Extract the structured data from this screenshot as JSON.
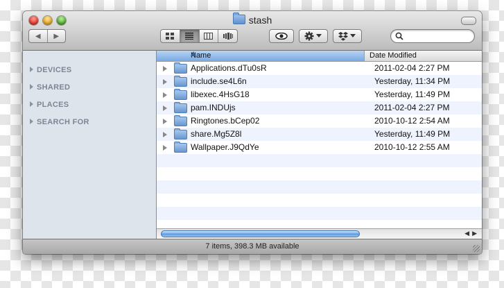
{
  "window": {
    "title": "stash"
  },
  "toolbar": {
    "back_glyph": "◀",
    "forward_glyph": "▶",
    "view_modes": [
      "icon-view",
      "list-view",
      "column-view",
      "coverflow-view"
    ],
    "active_view": "list-view",
    "search": {
      "value": "",
      "placeholder": ""
    }
  },
  "sidebar": {
    "sections": [
      {
        "label": "DEVICES"
      },
      {
        "label": "SHARED"
      },
      {
        "label": "PLACES"
      },
      {
        "label": "SEARCH FOR"
      }
    ]
  },
  "list": {
    "columns": [
      {
        "label": "Name",
        "sorted": true
      },
      {
        "label": "Date Modified"
      }
    ],
    "rows": [
      {
        "name": "Applications.dTu0sR",
        "date": "2011-02-04 2:27 PM"
      },
      {
        "name": "include.se4L6n",
        "date": "Yesterday, 11:34 PM"
      },
      {
        "name": "libexec.4HsG18",
        "date": "Yesterday, 11:49 PM"
      },
      {
        "name": "pam.INDUjs",
        "date": "2011-02-04 2:27 PM"
      },
      {
        "name": "Ringtones.bCep02",
        "date": "2010-10-12 2:54 AM"
      },
      {
        "name": "share.Mg5Z8l",
        "date": "Yesterday, 11:49 PM"
      },
      {
        "name": "Wallpaper.J9QdYe",
        "date": "2010-10-12 2:55 AM"
      }
    ]
  },
  "status": {
    "text": "7 items, 398.3 MB available"
  },
  "colors": {
    "selection_header": "#79a9e3",
    "row_alt": "#eef3fd",
    "sidebar": "#dde4ec"
  }
}
